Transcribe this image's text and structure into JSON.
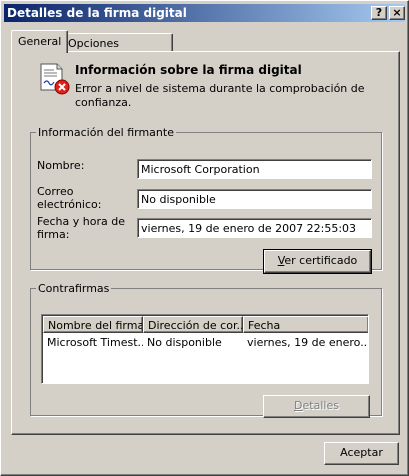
{
  "window": {
    "title": "Detalles de la firma digital",
    "help_label": "?",
    "close_label": "×"
  },
  "tabs": [
    {
      "label": "General"
    },
    {
      "label": "Opciones avanzadas"
    }
  ],
  "header": {
    "title": "Información sobre la firma digital",
    "message": "Error a nivel de sistema durante la comprobación de confianza.",
    "icon": "certificate-error-icon"
  },
  "signer": {
    "legend": "Información del firmante",
    "name_label": "Nombre:",
    "name_value": "Microsoft Corporation",
    "email_label_1": "Correo",
    "email_label_2": "electrónico:",
    "email_value": "No disponible",
    "datetime_label_1": "Fecha y hora de",
    "datetime_label_2": "firma:",
    "datetime_value": "viernes, 19 de enero de 2007 22:55:03",
    "view_cert_accel": "V",
    "view_cert_rest": "er certificado"
  },
  "countersignatures": {
    "legend": "Contrafirmas",
    "columns": [
      "Nombre del firma...",
      "Dirección de cor...",
      "Fecha"
    ],
    "rows": [
      [
        "Microsoft Timest...",
        "No disponible",
        "viernes, 19 de enero..."
      ]
    ],
    "details_accel": "D",
    "details_rest": "etalles"
  },
  "footer": {
    "accept_label": "Aceptar"
  },
  "colors": {
    "face": "#d4d0c8",
    "title_start": "#0a246a",
    "title_end": "#a6caf0",
    "error_red": "#e0201b"
  }
}
